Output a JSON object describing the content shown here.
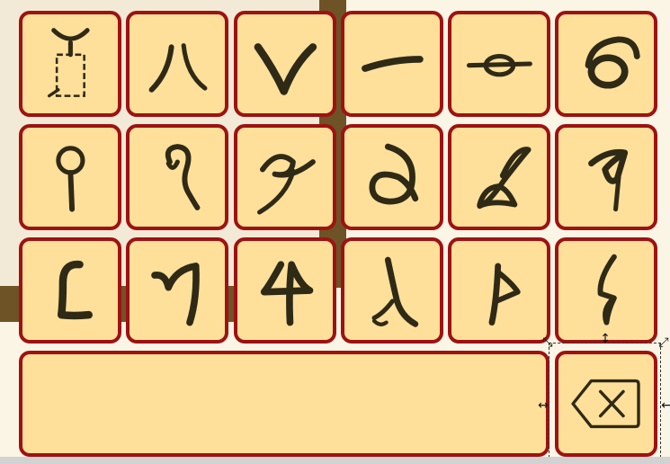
{
  "keyboard": {
    "rows": [
      [
        {
          "name": "placeholder-glyph",
          "glyph": "cursor"
        },
        {
          "name": "ba-glyph",
          "glyph": "ba"
        },
        {
          "name": "va-glyph",
          "glyph": "v"
        },
        {
          "name": "ma-glyph",
          "glyph": "dash"
        },
        {
          "name": "ka-glyph",
          "glyph": "knot"
        },
        {
          "name": "ga-glyph",
          "glyph": "swirl"
        }
      ],
      [
        {
          "name": "pin-glyph",
          "glyph": "pin"
        },
        {
          "name": "hook-glyph",
          "glyph": "hook"
        },
        {
          "name": "cross-glyph",
          "glyph": "cross"
        },
        {
          "name": "loop-glyph",
          "glyph": "loop"
        },
        {
          "name": "scroll-glyph",
          "glyph": "scroll"
        },
        {
          "name": "flag-glyph",
          "glyph": "flag"
        }
      ],
      [
        {
          "name": "bracket-glyph",
          "glyph": "bracket"
        },
        {
          "name": "seven-glyph",
          "glyph": "seven"
        },
        {
          "name": "four-glyph",
          "glyph": "four"
        },
        {
          "name": "lambda-glyph",
          "glyph": "lambda"
        },
        {
          "name": "pennant-glyph",
          "glyph": "pennant"
        },
        {
          "name": "spike-glyph",
          "glyph": "spike"
        }
      ]
    ],
    "space_key": {
      "label": ""
    },
    "backspace_key": {
      "icon": "backspace-icon"
    }
  },
  "colors": {
    "key_fill": "#ffe09a",
    "key_border": "#9e1212",
    "glyph_ink": "#2f2a16"
  }
}
